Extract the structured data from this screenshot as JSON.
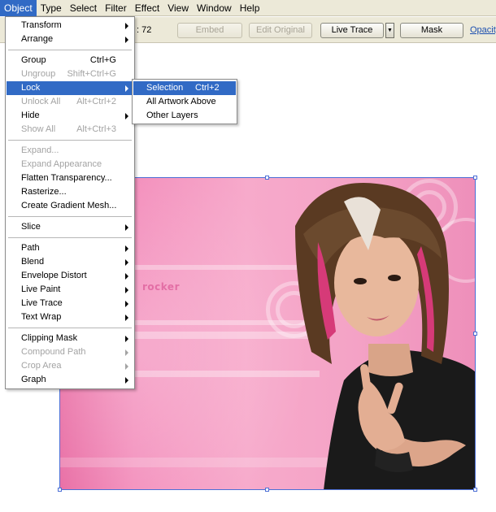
{
  "menubar": {
    "items": [
      "Object",
      "Type",
      "Select",
      "Filter",
      "Effect",
      "View",
      "Window",
      "Help"
    ],
    "active": "Object"
  },
  "controlbar": {
    "resolution": ": 72",
    "embed_label": "Embed",
    "edit_original_label": "Edit Original",
    "live_trace_label": "Live Trace",
    "mask_label": "Mask",
    "opacity_label": "Opacity"
  },
  "object_menu": {
    "items": [
      {
        "label": "Transform",
        "shortcut": "",
        "submenu": true,
        "disabled": false
      },
      {
        "label": "Arrange",
        "shortcut": "",
        "submenu": true,
        "disabled": false
      },
      {
        "label": "Group",
        "shortcut": "Ctrl+G",
        "submenu": false,
        "disabled": false
      },
      {
        "label": "Ungroup",
        "shortcut": "Shift+Ctrl+G",
        "submenu": false,
        "disabled": true
      },
      {
        "label": "Lock",
        "shortcut": "",
        "submenu": true,
        "disabled": false,
        "highlighted": true
      },
      {
        "label": "Unlock All",
        "shortcut": "Alt+Ctrl+2",
        "submenu": false,
        "disabled": true
      },
      {
        "label": "Hide",
        "shortcut": "",
        "submenu": true,
        "disabled": false
      },
      {
        "label": "Show All",
        "shortcut": "Alt+Ctrl+3",
        "submenu": false,
        "disabled": true
      },
      {
        "label": "Expand...",
        "shortcut": "",
        "submenu": false,
        "disabled": true
      },
      {
        "label": "Expand Appearance",
        "shortcut": "",
        "submenu": false,
        "disabled": true
      },
      {
        "label": "Flatten Transparency...",
        "shortcut": "",
        "submenu": false,
        "disabled": false
      },
      {
        "label": "Rasterize...",
        "shortcut": "",
        "submenu": false,
        "disabled": false
      },
      {
        "label": "Create Gradient Mesh...",
        "shortcut": "",
        "submenu": false,
        "disabled": false
      },
      {
        "label": "Slice",
        "shortcut": "",
        "submenu": true,
        "disabled": false
      },
      {
        "label": "Path",
        "shortcut": "",
        "submenu": true,
        "disabled": false
      },
      {
        "label": "Blend",
        "shortcut": "",
        "submenu": true,
        "disabled": false
      },
      {
        "label": "Envelope Distort",
        "shortcut": "",
        "submenu": true,
        "disabled": false
      },
      {
        "label": "Live Paint",
        "shortcut": "",
        "submenu": true,
        "disabled": false
      },
      {
        "label": "Live Trace",
        "shortcut": "",
        "submenu": true,
        "disabled": false
      },
      {
        "label": "Text Wrap",
        "shortcut": "",
        "submenu": true,
        "disabled": false
      },
      {
        "label": "Clipping Mask",
        "shortcut": "",
        "submenu": true,
        "disabled": false
      },
      {
        "label": "Compound Path",
        "shortcut": "",
        "submenu": true,
        "disabled": true
      },
      {
        "label": "Crop Area",
        "shortcut": "",
        "submenu": true,
        "disabled": true
      },
      {
        "label": "Graph",
        "shortcut": "",
        "submenu": true,
        "disabled": false
      }
    ]
  },
  "lock_submenu": {
    "items": [
      {
        "label": "Selection",
        "shortcut": "Ctrl+2",
        "highlighted": true
      },
      {
        "label": "All Artwork Above",
        "shortcut": ""
      },
      {
        "label": "Other Layers",
        "shortcut": ""
      }
    ]
  },
  "artwork": {
    "text": "rocker",
    "accent_color": "#e36ea5",
    "selection_color": "#4c6fd6"
  }
}
